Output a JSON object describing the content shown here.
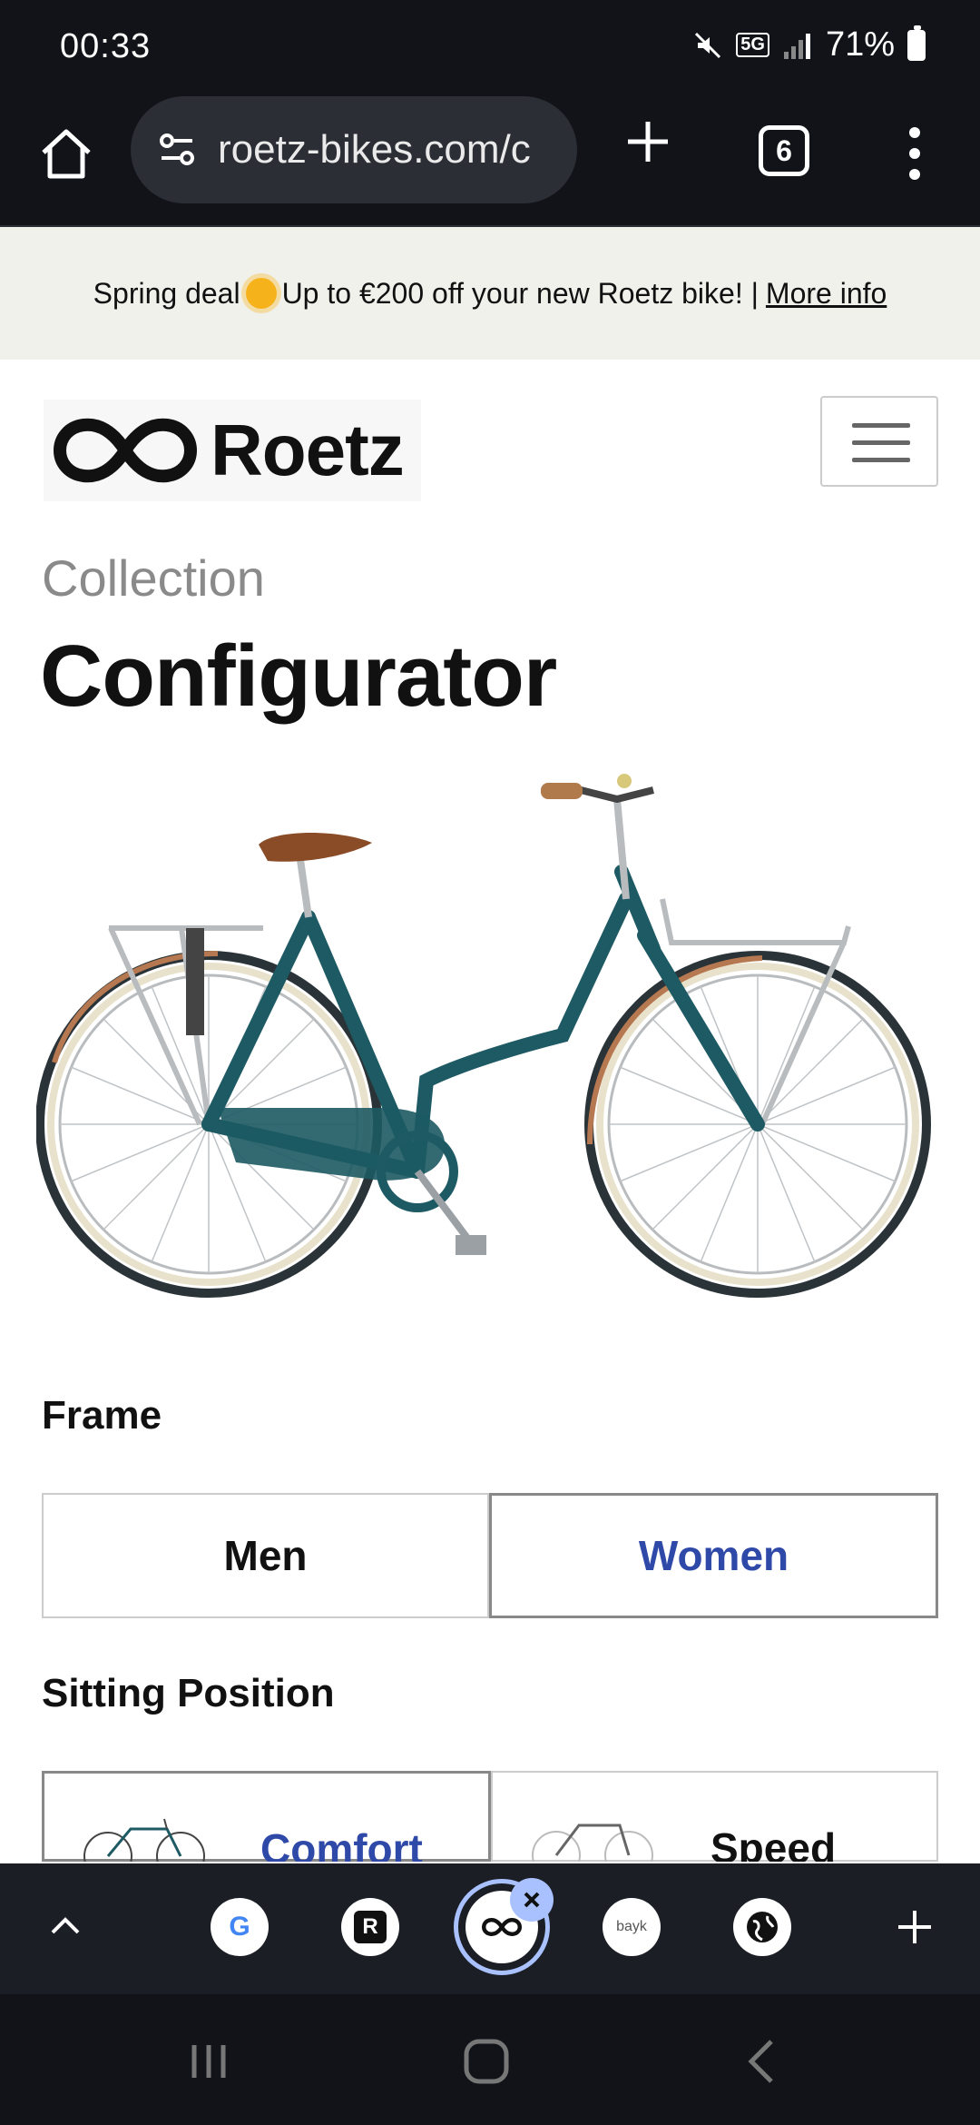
{
  "status": {
    "time": "00:33",
    "network": "5G",
    "battery": "71%"
  },
  "browser": {
    "url": "roetz-bikes.com/c",
    "tab_count": "6"
  },
  "promo": {
    "text": "Spring deal",
    "text_after": "Up to €200 off your new Roetz bike! |",
    "link": "More info"
  },
  "header": {
    "brand": "Roetz"
  },
  "page": {
    "kicker": "Collection",
    "title": "Configurator"
  },
  "frame": {
    "label": "Frame",
    "options": [
      "Men",
      "Women"
    ],
    "selected": "Women"
  },
  "sitting": {
    "label": "Sitting Position",
    "options": [
      "Comfort",
      "Speed"
    ],
    "selected": "Comfort"
  },
  "dock": {
    "tabs": [
      "google",
      "r-site",
      "roetz",
      "bayk",
      "globe"
    ],
    "bayk_label": "bayk"
  },
  "colors": {
    "bike_frame": "#1d5a63",
    "accent": "#2f49a8",
    "dock_ring": "#a9c2ff"
  }
}
